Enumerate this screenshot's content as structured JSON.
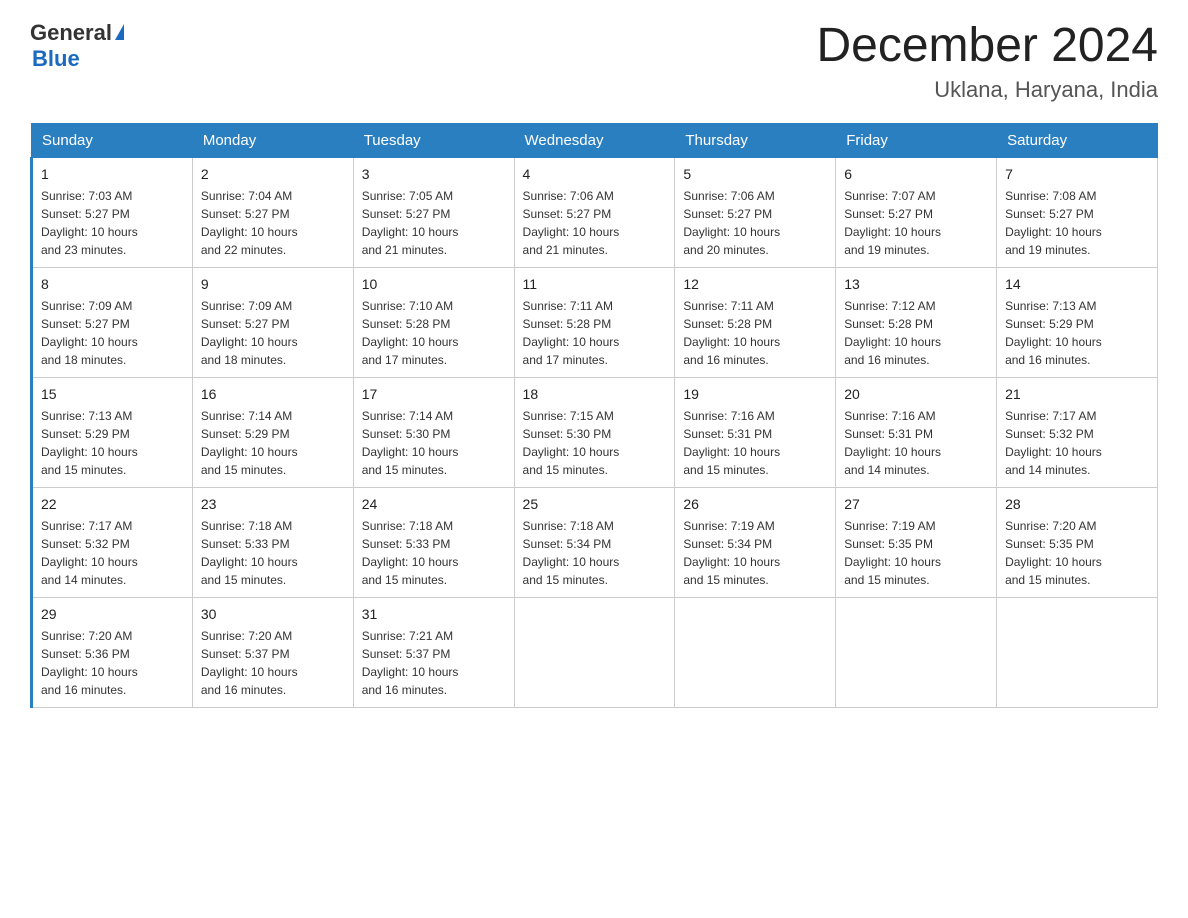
{
  "header": {
    "logo_general": "General",
    "logo_blue": "Blue",
    "month_year": "December 2024",
    "location": "Uklana, Haryana, India"
  },
  "days_of_week": [
    "Sunday",
    "Monday",
    "Tuesday",
    "Wednesday",
    "Thursday",
    "Friday",
    "Saturday"
  ],
  "weeks": [
    [
      {
        "day": "1",
        "sunrise": "7:03 AM",
        "sunset": "5:27 PM",
        "daylight": "10 hours and 23 minutes."
      },
      {
        "day": "2",
        "sunrise": "7:04 AM",
        "sunset": "5:27 PM",
        "daylight": "10 hours and 22 minutes."
      },
      {
        "day": "3",
        "sunrise": "7:05 AM",
        "sunset": "5:27 PM",
        "daylight": "10 hours and 21 minutes."
      },
      {
        "day": "4",
        "sunrise": "7:06 AM",
        "sunset": "5:27 PM",
        "daylight": "10 hours and 21 minutes."
      },
      {
        "day": "5",
        "sunrise": "7:06 AM",
        "sunset": "5:27 PM",
        "daylight": "10 hours and 20 minutes."
      },
      {
        "day": "6",
        "sunrise": "7:07 AM",
        "sunset": "5:27 PM",
        "daylight": "10 hours and 19 minutes."
      },
      {
        "day": "7",
        "sunrise": "7:08 AM",
        "sunset": "5:27 PM",
        "daylight": "10 hours and 19 minutes."
      }
    ],
    [
      {
        "day": "8",
        "sunrise": "7:09 AM",
        "sunset": "5:27 PM",
        "daylight": "10 hours and 18 minutes."
      },
      {
        "day": "9",
        "sunrise": "7:09 AM",
        "sunset": "5:27 PM",
        "daylight": "10 hours and 18 minutes."
      },
      {
        "day": "10",
        "sunrise": "7:10 AM",
        "sunset": "5:28 PM",
        "daylight": "10 hours and 17 minutes."
      },
      {
        "day": "11",
        "sunrise": "7:11 AM",
        "sunset": "5:28 PM",
        "daylight": "10 hours and 17 minutes."
      },
      {
        "day": "12",
        "sunrise": "7:11 AM",
        "sunset": "5:28 PM",
        "daylight": "10 hours and 16 minutes."
      },
      {
        "day": "13",
        "sunrise": "7:12 AM",
        "sunset": "5:28 PM",
        "daylight": "10 hours and 16 minutes."
      },
      {
        "day": "14",
        "sunrise": "7:13 AM",
        "sunset": "5:29 PM",
        "daylight": "10 hours and 16 minutes."
      }
    ],
    [
      {
        "day": "15",
        "sunrise": "7:13 AM",
        "sunset": "5:29 PM",
        "daylight": "10 hours and 15 minutes."
      },
      {
        "day": "16",
        "sunrise": "7:14 AM",
        "sunset": "5:29 PM",
        "daylight": "10 hours and 15 minutes."
      },
      {
        "day": "17",
        "sunrise": "7:14 AM",
        "sunset": "5:30 PM",
        "daylight": "10 hours and 15 minutes."
      },
      {
        "day": "18",
        "sunrise": "7:15 AM",
        "sunset": "5:30 PM",
        "daylight": "10 hours and 15 minutes."
      },
      {
        "day": "19",
        "sunrise": "7:16 AM",
        "sunset": "5:31 PM",
        "daylight": "10 hours and 15 minutes."
      },
      {
        "day": "20",
        "sunrise": "7:16 AM",
        "sunset": "5:31 PM",
        "daylight": "10 hours and 14 minutes."
      },
      {
        "day": "21",
        "sunrise": "7:17 AM",
        "sunset": "5:32 PM",
        "daylight": "10 hours and 14 minutes."
      }
    ],
    [
      {
        "day": "22",
        "sunrise": "7:17 AM",
        "sunset": "5:32 PM",
        "daylight": "10 hours and 14 minutes."
      },
      {
        "day": "23",
        "sunrise": "7:18 AM",
        "sunset": "5:33 PM",
        "daylight": "10 hours and 15 minutes."
      },
      {
        "day": "24",
        "sunrise": "7:18 AM",
        "sunset": "5:33 PM",
        "daylight": "10 hours and 15 minutes."
      },
      {
        "day": "25",
        "sunrise": "7:18 AM",
        "sunset": "5:34 PM",
        "daylight": "10 hours and 15 minutes."
      },
      {
        "day": "26",
        "sunrise": "7:19 AM",
        "sunset": "5:34 PM",
        "daylight": "10 hours and 15 minutes."
      },
      {
        "day": "27",
        "sunrise": "7:19 AM",
        "sunset": "5:35 PM",
        "daylight": "10 hours and 15 minutes."
      },
      {
        "day": "28",
        "sunrise": "7:20 AM",
        "sunset": "5:35 PM",
        "daylight": "10 hours and 15 minutes."
      }
    ],
    [
      {
        "day": "29",
        "sunrise": "7:20 AM",
        "sunset": "5:36 PM",
        "daylight": "10 hours and 16 minutes."
      },
      {
        "day": "30",
        "sunrise": "7:20 AM",
        "sunset": "5:37 PM",
        "daylight": "10 hours and 16 minutes."
      },
      {
        "day": "31",
        "sunrise": "7:21 AM",
        "sunset": "5:37 PM",
        "daylight": "10 hours and 16 minutes."
      },
      null,
      null,
      null,
      null
    ]
  ],
  "labels": {
    "sunrise_prefix": "Sunrise: ",
    "sunset_prefix": "Sunset: ",
    "daylight_prefix": "Daylight: "
  }
}
